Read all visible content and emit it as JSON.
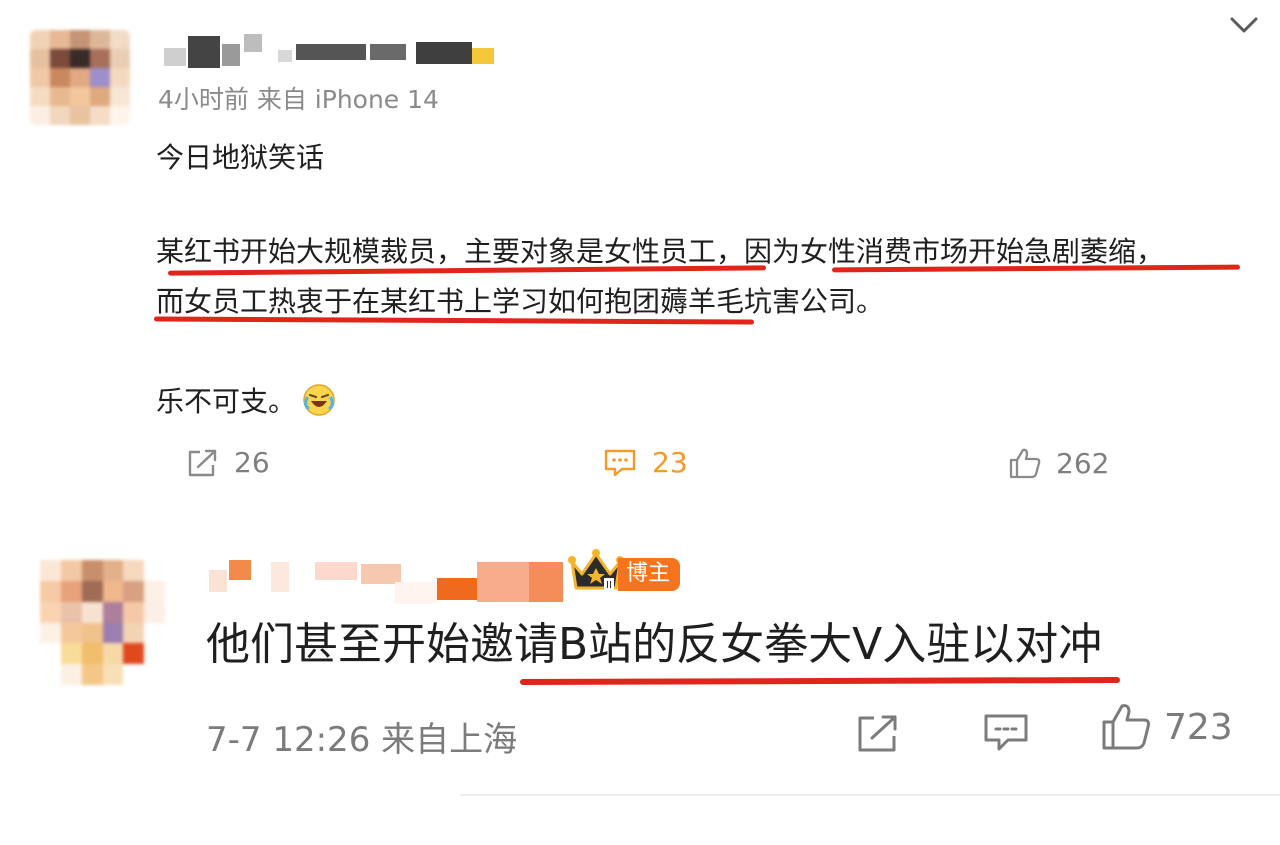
{
  "post1": {
    "meta": "4小时前  来自 iPhone 14",
    "line_a": "今日地狱笑话",
    "line_b": "某红书开始大规模裁员，主要对象是女性员工，因为女性消费市场开始急剧萎缩，",
    "line_c": "而女员工热衷于在某红书上学习如何抱团薅羊毛坑害公司。",
    "line_d": "乐不可支。",
    "emoji_icon": "laughing-tears-emoji",
    "actions": {
      "repost_count": "26",
      "comment_count": "23",
      "like_count": "262"
    },
    "comment_color": "#f7a238",
    "icon_color": "#8a8a8a"
  },
  "post2": {
    "badge_label": "博主",
    "badge_color": "#f7741f",
    "text": "他们甚至开始邀请B站的反女拳大V入驻以对冲",
    "meta": "7-7 12:26  来自上海",
    "like_count": "723"
  },
  "annotation_color": "#e0261b"
}
